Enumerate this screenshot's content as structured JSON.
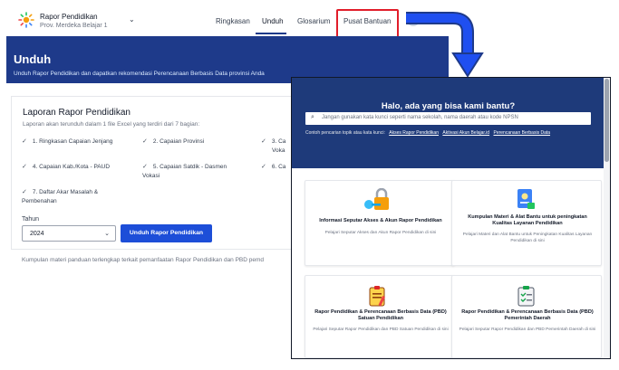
{
  "header": {
    "app_title": "Rapor Pendidikan",
    "app_subtitle": "Prov. Merdeka Belajar 1",
    "nav": [
      "Ringkasan",
      "Unduh",
      "Glosarium",
      "Pusat Bantuan"
    ],
    "active_nav": "Unduh",
    "highlighted_nav": "Pusat Bantuan"
  },
  "unduh": {
    "title": "Unduh",
    "description": "Unduh Rapor Pendidikan dan dapatkan rekomendasi Perencanaan Berbasis Data provinsi Anda",
    "card_title": "Laporan Rapor Pendidikan",
    "card_description": "Laporan akan terunduh dalam 1 file Excel yang terdiri dari 7 bagian:",
    "sections": [
      "1. Ringkasan Capaian Jenjang",
      "2. Capaian Provinsi",
      "3. Ca",
      "Voka",
      "4. Capaian Kab./Kota - PAUD",
      "5. Capaian Satdik - Dasmen Vokasi",
      "6. Ca",
      "7. Daftar Akar Masalah & Pembenahan"
    ],
    "year_label": "Tahun",
    "year_value": "2024",
    "download_button": "Unduh Rapor Pendidikan",
    "footer_note": "Kumpulan materi panduan terlengkap terkait pemanfaatan Rapor Pendidikan dan PBD pemd"
  },
  "help": {
    "title": "Halo, ada yang bisa kami bantu?",
    "search_placeholder": "Jangan gunakan kata kunci seperti nama sekolah, nama daerah atau kode NPSN",
    "examples_label": "Contoh pencarian topik atau kata kunci:",
    "examples": [
      "Akses Rapor Pendidikan",
      "Aktivasi Akun Belajar.id",
      "Perencanaan Berbasis Data"
    ],
    "cards": [
      {
        "title": "Informasi Seputar Akses & Akun Rapor Pendidikan",
        "desc": "Pelajari Seputar Akses dan Akun Rapor Pendidikan di sini"
      },
      {
        "title": "Kumpulan Materi & Alat Bantu untuk peningkatan Kualitas Layanan Pendidikan",
        "desc": "Pelajari Materi dan Alat Bantu untuk Peningkatan Kualitas Layanan Pendidikan di sini"
      },
      {
        "title": "Rapor Pendidikan & Perencanaan Berbasis Data (PBD) Satuan Pendidikan",
        "desc": "Pelajari Seputar Rapor Pendidikan dan PBD Satuan Pendidikan di sini"
      },
      {
        "title": "Rapor Pendidikan & Perencanaan Berbasis Data (PBD) Pemerintah Daerah",
        "desc": "Pelajari Seputar Rapor Pendidikan dan PBD Pemerintah Daerah di sini"
      }
    ]
  },
  "colors": {
    "primary_navy": "#1e3a8a",
    "button_blue": "#1d4ed8",
    "highlight_red": "#e11d2a",
    "arrow_blue": "#1f4ff0"
  },
  "icons": [
    "sun-logo-icon",
    "chevron-down-icon",
    "check-icon",
    "search-icon",
    "key-lock-icon",
    "document-badge-icon",
    "clipboard-pencil-icon",
    "clipboard-check-icon",
    "curved-arrow-icon"
  ]
}
